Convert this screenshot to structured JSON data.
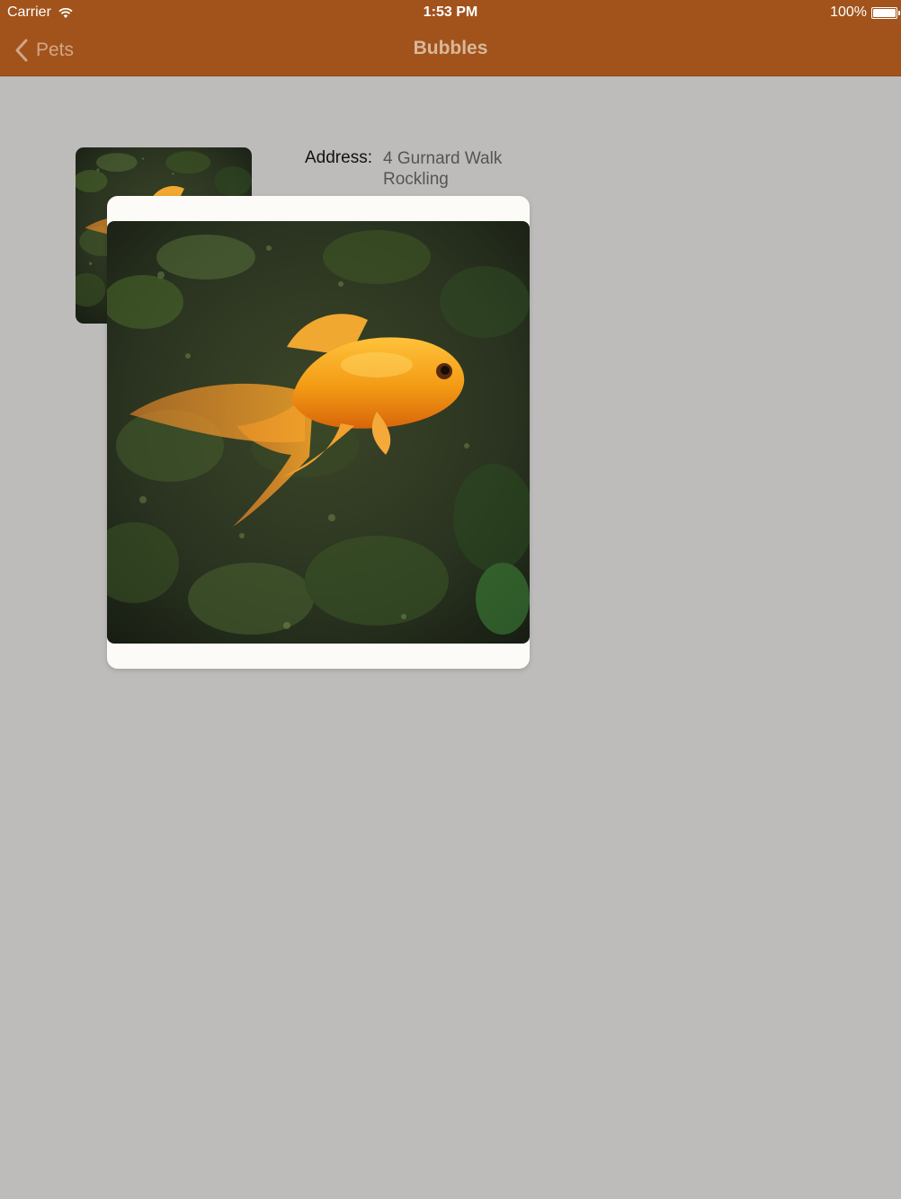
{
  "status_bar": {
    "carrier": "Carrier",
    "time": "1:53 PM",
    "battery_percent": "100%",
    "battery_level": 1.0
  },
  "nav": {
    "back_label": "Pets",
    "title": "Bubbles"
  },
  "detail": {
    "address_label": "Address:",
    "address_line1": "4 Gurnard Walk",
    "address_line2": "Rockling"
  },
  "colors": {
    "nav_background": "#a2531b",
    "page_background": "#bdbcbb",
    "popover_background": "#fcfbf7"
  },
  "icons": {
    "back": "chevron-left-icon",
    "wifi": "wifi-icon",
    "battery": "battery-icon"
  }
}
